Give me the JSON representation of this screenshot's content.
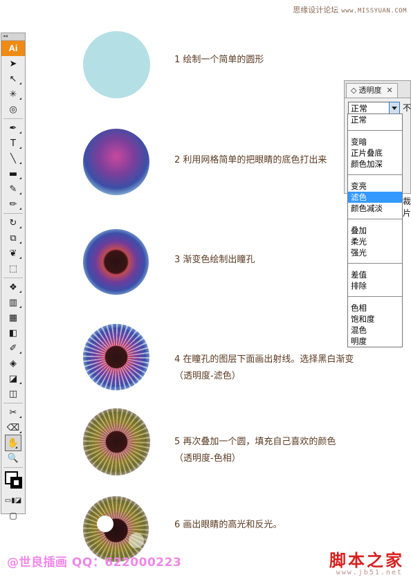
{
  "watermark_top": {
    "site_cn": "思缘设计论坛",
    "url": "www.MISSYUAN.COM"
  },
  "toolbar": {
    "logo": "Ai",
    "grip": "◂◂",
    "tools": [
      {
        "name": "selection-tool",
        "glyph": "➤",
        "flyout": false
      },
      {
        "name": "direct-selection-tool",
        "glyph": "↖",
        "flyout": true
      },
      {
        "name": "magic-wand-tool",
        "glyph": "✳",
        "flyout": true
      },
      {
        "name": "lasso-tool",
        "glyph": "◎",
        "flyout": false
      },
      {
        "name": "pen-tool",
        "glyph": "✒",
        "flyout": true
      },
      {
        "name": "type-tool",
        "glyph": "T",
        "flyout": true
      },
      {
        "name": "line-tool",
        "glyph": "╲",
        "flyout": true
      },
      {
        "name": "rectangle-tool",
        "glyph": "▬",
        "flyout": true
      },
      {
        "name": "paintbrush-tool",
        "glyph": "✎",
        "flyout": true
      },
      {
        "name": "pencil-tool",
        "glyph": "✏",
        "flyout": true
      },
      {
        "name": "rotate-tool",
        "glyph": "↻",
        "flyout": true
      },
      {
        "name": "scale-tool",
        "glyph": "⧉",
        "flyout": true
      },
      {
        "name": "warp-tool",
        "glyph": "❦",
        "flyout": true
      },
      {
        "name": "free-transform-tool",
        "glyph": "⬚",
        "flyout": false
      },
      {
        "name": "symbol-sprayer-tool",
        "glyph": "❖",
        "flyout": true
      },
      {
        "name": "column-graph-tool",
        "glyph": "▥",
        "flyout": true
      },
      {
        "name": "mesh-tool",
        "glyph": "▦",
        "flyout": false
      },
      {
        "name": "gradient-tool",
        "glyph": "◧",
        "flyout": false
      },
      {
        "name": "eyedropper-tool",
        "glyph": "✐",
        "flyout": true
      },
      {
        "name": "blend-tool",
        "glyph": "◈",
        "flyout": false
      },
      {
        "name": "live-paint-bucket-tool",
        "glyph": "◪",
        "flyout": true
      },
      {
        "name": "live-paint-selection-tool",
        "glyph": "◫",
        "flyout": false
      },
      {
        "name": "slice-tool",
        "glyph": "✂",
        "flyout": true
      },
      {
        "name": "eraser-tool",
        "glyph": "⌫",
        "flyout": true
      },
      {
        "name": "hand-tool",
        "glyph": "✋",
        "flyout": true,
        "selected": true
      },
      {
        "name": "zoom-tool",
        "glyph": "🔍",
        "flyout": false
      }
    ]
  },
  "steps": [
    {
      "text": "1 绘制一个简单的圆形"
    },
    {
      "text": "2 利用网格简单的把眼睛的底色打出来"
    },
    {
      "text": "3 渐变色绘制出瞳孔"
    },
    {
      "text": "4 在瞳孔的图层下面画出射线。选择黑白渐变",
      "text2": "（透明度-滤色）"
    },
    {
      "text": "5 再次叠加一个圆，填充自己喜欢的颜色",
      "text2": "（透明度-色相）"
    },
    {
      "text": "6 画出眼睛的高光和反光。"
    }
  ],
  "transparency_panel": {
    "tab_label": "透明度",
    "tab_icon": "◇",
    "close": "✕",
    "selected_mode": "正常",
    "opacity_label": "不",
    "bleed_label": "裁片",
    "dropdown_groups": [
      [
        "正常"
      ],
      [
        "变暗",
        "正片叠底",
        "颜色加深"
      ],
      [
        "变亮",
        "滤色",
        "颜色减淡"
      ],
      [
        "叠加",
        "柔光",
        "强光"
      ],
      [
        "差值",
        "排除"
      ],
      [
        "色相",
        "饱和度",
        "混色",
        "明度"
      ]
    ],
    "highlighted_item": "滤色"
  },
  "watermark_bottom_left": "@世良插画 QQ：622000223",
  "watermark_bottom_right": "脚本之家",
  "watermark_bottom_right_url": "www.jb51.net"
}
